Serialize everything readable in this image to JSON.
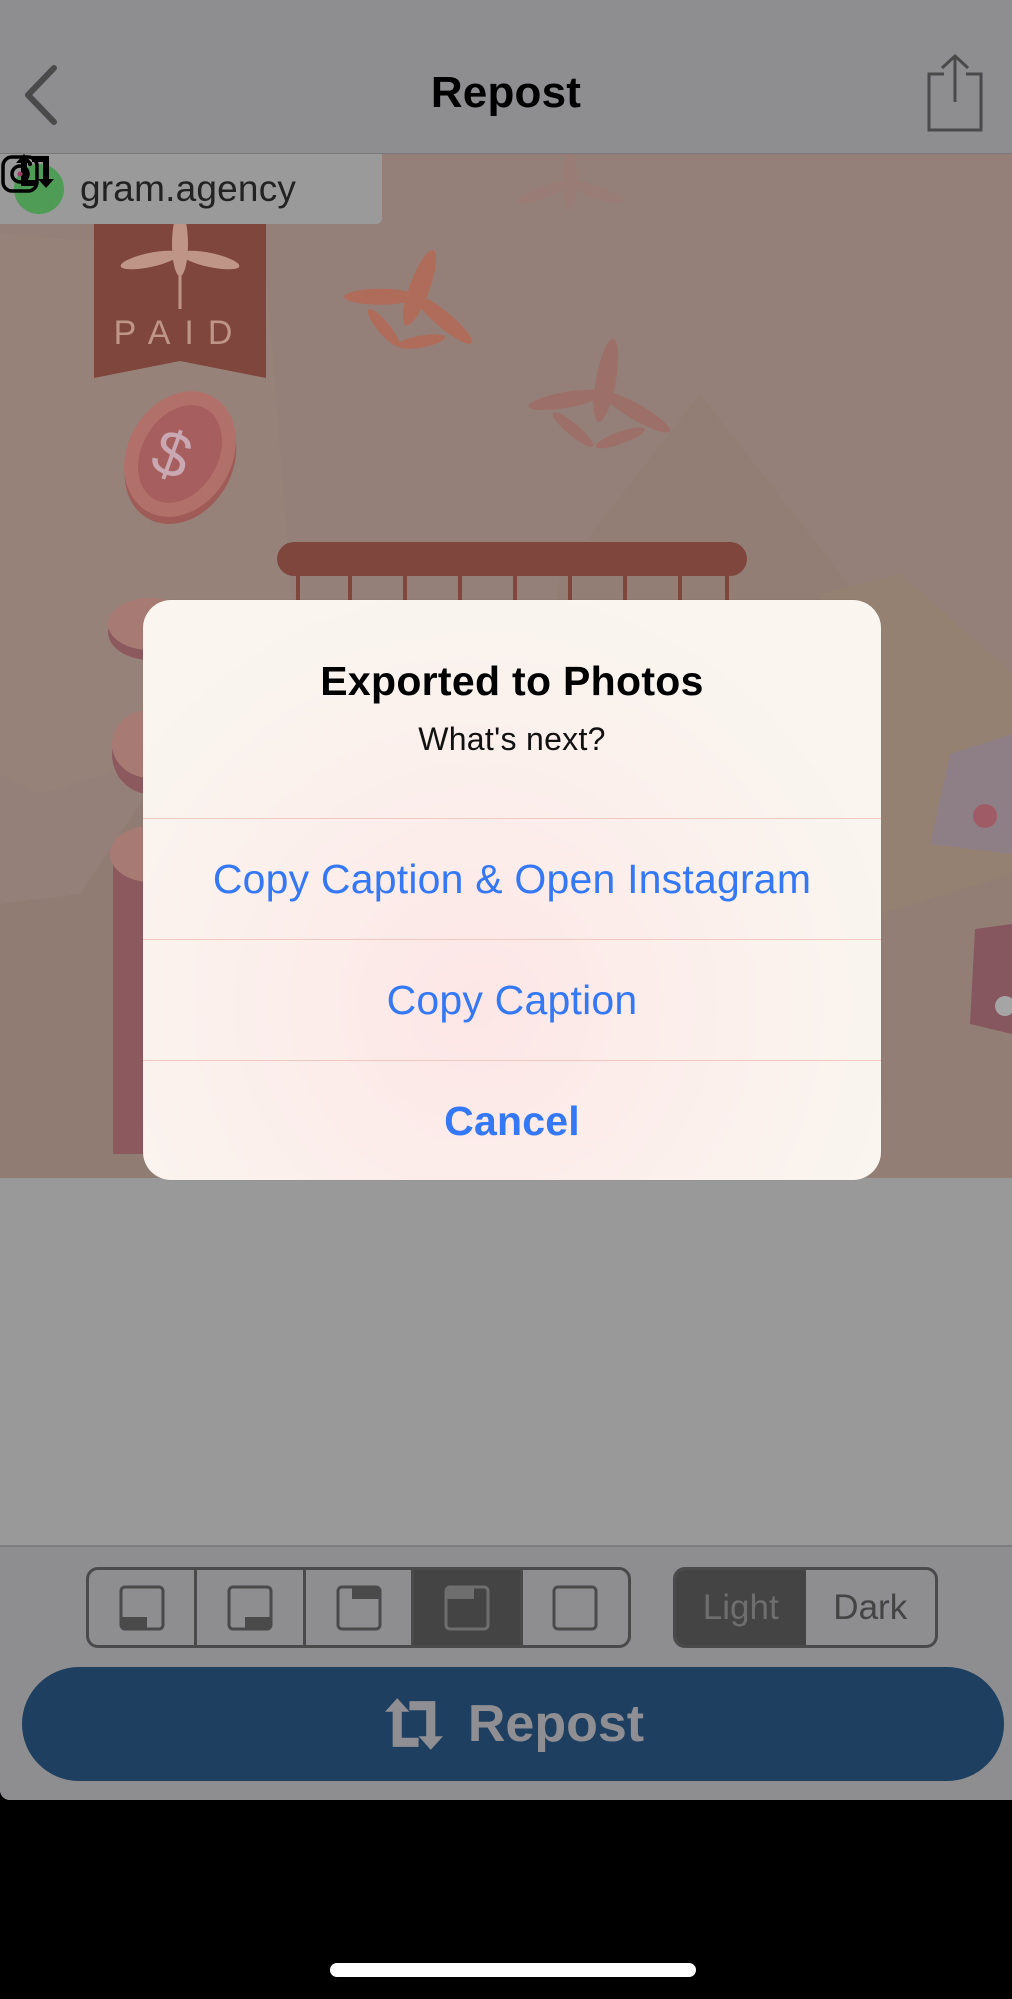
{
  "nav": {
    "title": "Repost",
    "back_icon": "chevron-left-icon",
    "share_icon": "share-icon"
  },
  "post": {
    "attribution_icon": "repost-icon",
    "avatar_icon": "instagram-icon",
    "username": "gram.agency",
    "image_text": "PAID",
    "image_description": "Illustration with PAID banner, dollar coin, coin stacks, cannabis leaves and basket"
  },
  "alert": {
    "title": "Exported to Photos",
    "message": "What's next?",
    "actions": [
      {
        "label": "Copy Caption & Open Instagram",
        "style": "default"
      },
      {
        "label": "Copy Caption",
        "style": "default"
      },
      {
        "label": "Cancel",
        "style": "cancel"
      }
    ]
  },
  "toolbar": {
    "layout_options": [
      {
        "name": "bottom-left",
        "selected": false
      },
      {
        "name": "bottom-right",
        "selected": false
      },
      {
        "name": "top-right",
        "selected": false
      },
      {
        "name": "top-left",
        "selected": true
      },
      {
        "name": "none",
        "selected": false
      }
    ],
    "theme_options": [
      {
        "label": "Light",
        "selected": true
      },
      {
        "label": "Dark",
        "selected": false
      }
    ],
    "repost_label": "Repost"
  },
  "colors": {
    "accent_blue": "#3478f6",
    "repost_button": "#1e3f60",
    "dim_overlay": "#999999"
  }
}
